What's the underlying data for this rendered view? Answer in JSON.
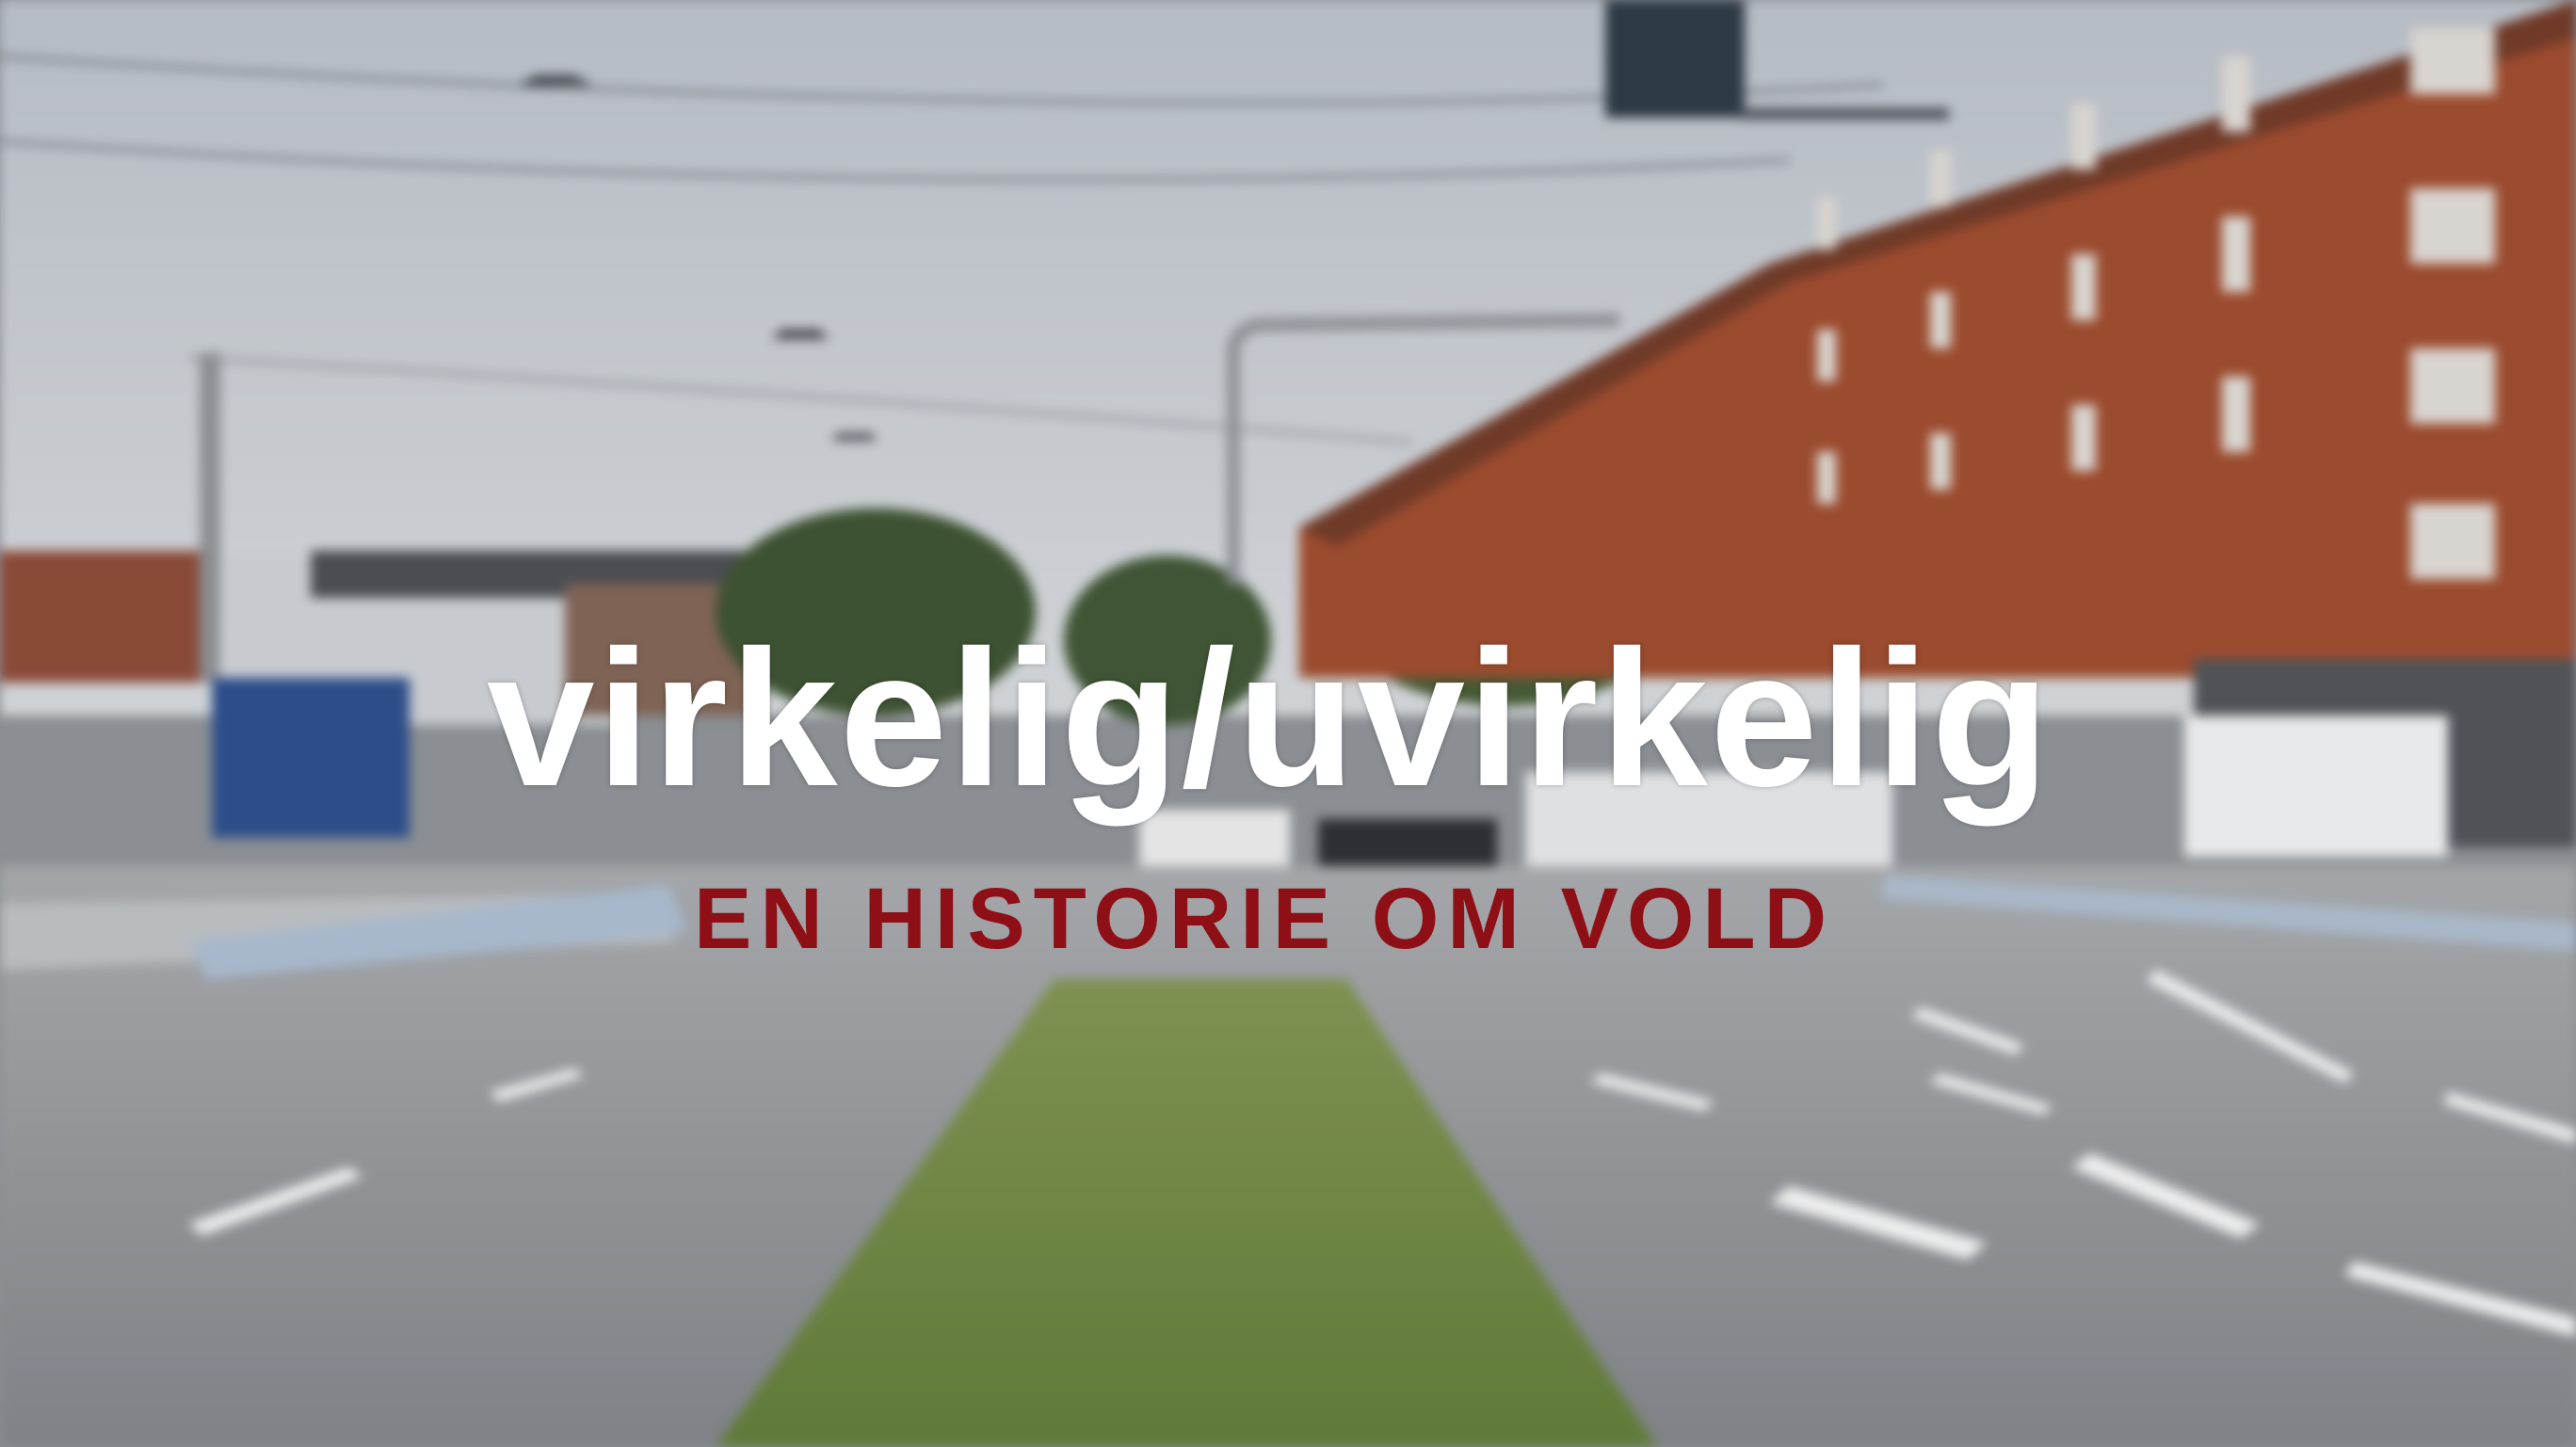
{
  "video_frame": {
    "title": "virkelig/uvirkelig",
    "subtitle": "EN HISTORIE OM VOLD"
  },
  "colors": {
    "title": "#ffffff",
    "subtitle": "#8e1016",
    "sky": "#c3c8ce",
    "road": "#8f9296",
    "grass": "#6f8a45",
    "brick": "#9b4b2e"
  }
}
